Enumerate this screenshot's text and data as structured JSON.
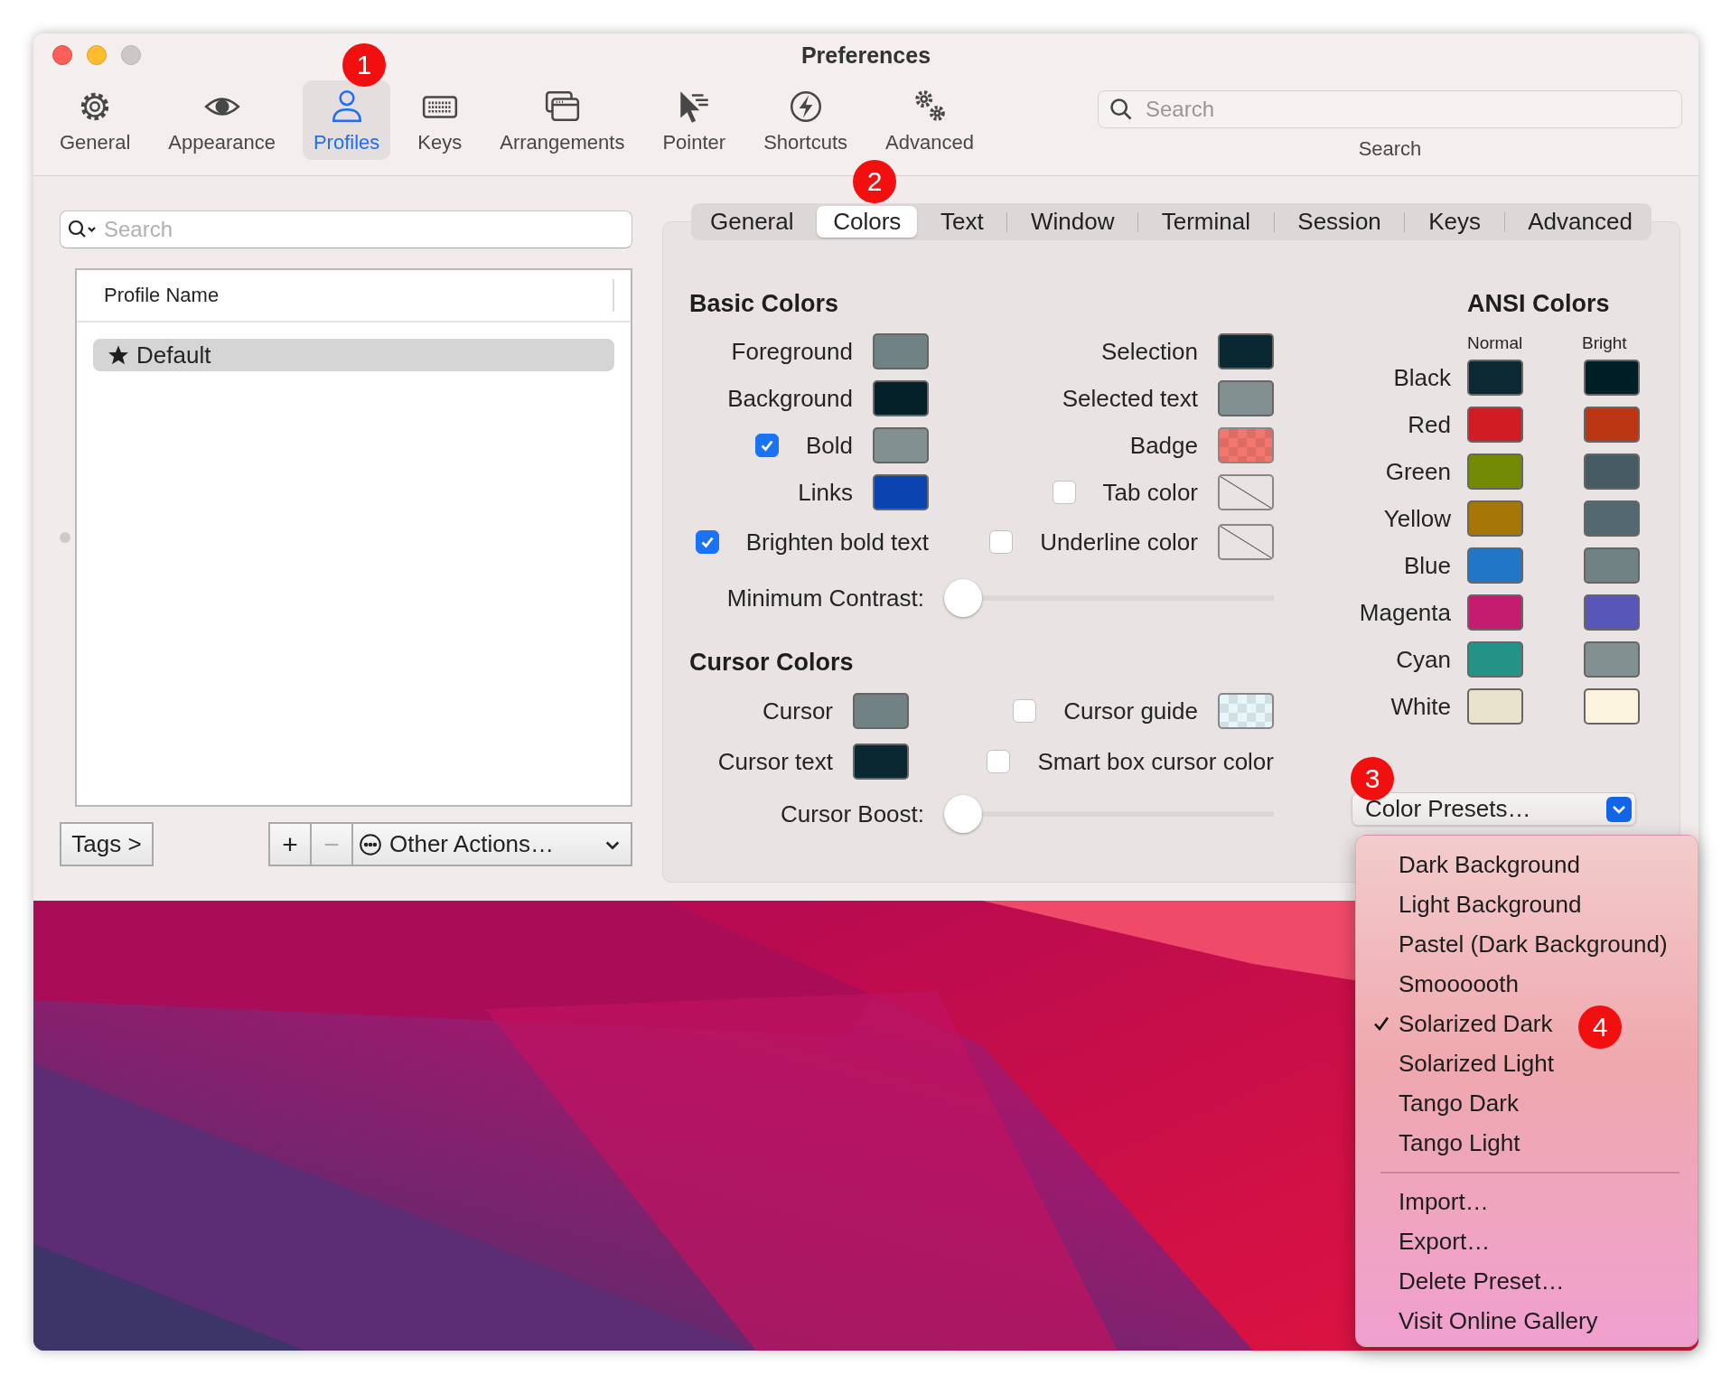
{
  "window": {
    "title": "Preferences"
  },
  "toolbar": {
    "items": [
      {
        "label": "General",
        "selected": false
      },
      {
        "label": "Appearance",
        "selected": false
      },
      {
        "label": "Profiles",
        "selected": true
      },
      {
        "label": "Keys",
        "selected": false
      },
      {
        "label": "Arrangements",
        "selected": false
      },
      {
        "label": "Pointer",
        "selected": false
      },
      {
        "label": "Shortcuts",
        "selected": false
      },
      {
        "label": "Advanced",
        "selected": false
      }
    ],
    "search": {
      "placeholder": "Search",
      "label": "Search"
    }
  },
  "annotations": [
    {
      "label": "1"
    },
    {
      "label": "2"
    },
    {
      "label": "3"
    },
    {
      "label": "4"
    }
  ],
  "profiles": {
    "search": {
      "placeholder": "Search"
    },
    "column": "Profile Name",
    "rows": [
      {
        "name": "Default",
        "selected": true
      }
    ],
    "tags_button": "Tags >",
    "add_button": {
      "label": "+",
      "disabled": false
    },
    "remove_button": {
      "label": "−",
      "disabled": true
    },
    "other_actions": "Other Actions…"
  },
  "tabs": [
    {
      "label": "General",
      "selected": false
    },
    {
      "label": "Colors",
      "selected": true
    },
    {
      "label": "Text",
      "selected": false
    },
    {
      "label": "Window",
      "selected": false
    },
    {
      "label": "Terminal",
      "selected": false
    },
    {
      "label": "Session",
      "selected": false
    },
    {
      "label": "Keys",
      "selected": false
    },
    {
      "label": "Advanced",
      "selected": false
    }
  ],
  "basic_colors": {
    "title": "Basic Colors",
    "left": [
      {
        "label": "Foreground",
        "swatch": {
          "kind": "solid",
          "color": "#708284"
        }
      },
      {
        "label": "Background",
        "swatch": {
          "kind": "solid",
          "color": "#042028"
        }
      },
      {
        "label": "Bold",
        "checked": true,
        "swatch": {
          "kind": "solid",
          "color": "#819090"
        }
      },
      {
        "label": "Links",
        "swatch": {
          "kind": "solid",
          "color": "#0b44b0"
        }
      },
      {
        "label": "Brighten bold text",
        "checked": true
      }
    ],
    "right": [
      {
        "label": "Selection",
        "swatch": {
          "kind": "solid",
          "color": "#0a2832"
        }
      },
      {
        "label": "Selected text",
        "swatch": {
          "kind": "solid",
          "color": "#819090"
        }
      },
      {
        "label": "Badge",
        "swatch": {
          "kind": "checker",
          "color": "#f3776e"
        }
      },
      {
        "label": "Tab color",
        "checked": false,
        "swatch": {
          "kind": "empty"
        }
      },
      {
        "label": "Underline color",
        "checked": false,
        "swatch": {
          "kind": "empty"
        }
      }
    ],
    "slider": {
      "label": "Minimum Contrast:",
      "level": 0
    }
  },
  "cursor_colors": {
    "title": "Cursor Colors",
    "left": [
      {
        "label": "Cursor",
        "swatch": {
          "kind": "solid",
          "color": "#708284"
        }
      },
      {
        "label": "Cursor text",
        "swatch": {
          "kind": "solid",
          "color": "#0a2832"
        }
      }
    ],
    "right": [
      {
        "label": "Cursor guide",
        "checked": false,
        "swatch": {
          "kind": "checker",
          "color": "#e6f6f9"
        }
      },
      {
        "label": "Smart box cursor color",
        "checked": false
      }
    ],
    "slider": {
      "label": "Cursor Boost:",
      "level": 0
    }
  },
  "ansi_colors": {
    "title": "ANSI Colors",
    "columns": [
      "Normal",
      "Bright"
    ],
    "rows": [
      {
        "label": "Black",
        "swatches": [
          {
            "color": "#0c2832"
          },
          {
            "color": "#001e26"
          }
        ]
      },
      {
        "label": "Red",
        "swatches": [
          {
            "color": "#d11c24"
          },
          {
            "color": "#bd3613"
          }
        ]
      },
      {
        "label": "Green",
        "swatches": [
          {
            "color": "#738a05"
          },
          {
            "color": "#475b62"
          }
        ]
      },
      {
        "label": "Yellow",
        "swatches": [
          {
            "color": "#a57706"
          },
          {
            "color": "#536870"
          }
        ]
      },
      {
        "label": "Blue",
        "swatches": [
          {
            "color": "#2176c7"
          },
          {
            "color": "#708284"
          }
        ]
      },
      {
        "label": "Magenta",
        "swatches": [
          {
            "color": "#c61c6f"
          },
          {
            "color": "#5956ba"
          }
        ]
      },
      {
        "label": "Cyan",
        "swatches": [
          {
            "color": "#259286"
          },
          {
            "color": "#819090"
          }
        ]
      },
      {
        "label": "White",
        "swatches": [
          {
            "color": "#eae3cb"
          },
          {
            "color": "#fcf4dc"
          }
        ]
      }
    ]
  },
  "color_presets": {
    "label": "Color Presets…",
    "presets": [
      {
        "label": "Dark Background",
        "checked": false
      },
      {
        "label": "Light Background",
        "checked": false
      },
      {
        "label": "Pastel (Dark Background)",
        "checked": false
      },
      {
        "label": "Smoooooth",
        "checked": false
      },
      {
        "label": "Solarized Dark",
        "checked": true
      },
      {
        "label": "Solarized Light",
        "checked": false
      },
      {
        "label": "Tango Dark",
        "checked": false
      },
      {
        "label": "Tango Light",
        "checked": false
      }
    ],
    "actions": [
      "Import…",
      "Export…",
      "Delete Preset…",
      "Visit Online Gallery"
    ]
  }
}
